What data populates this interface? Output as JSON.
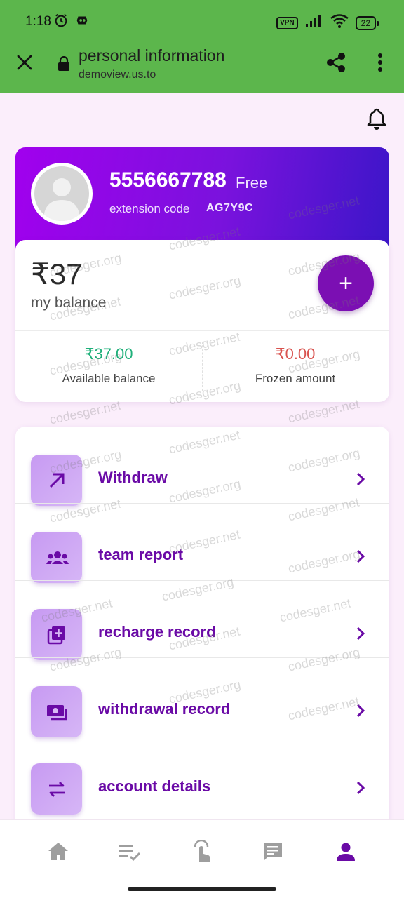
{
  "status_bar": {
    "time": "1:18",
    "vpn": "VPN",
    "battery": "22"
  },
  "browser": {
    "title": "personal information",
    "url": "demoview.us.to"
  },
  "profile": {
    "phone": "5556667788",
    "tier": "Free",
    "extension_label": "extension code",
    "extension_code": "AG7Y9C"
  },
  "balance": {
    "amount": "₹37",
    "label": "my balance",
    "add_symbol": "+",
    "available_value": "₹37.00",
    "available_label": "Available balance",
    "frozen_value": "₹0.00",
    "frozen_label": "Frozen amount"
  },
  "menu": [
    {
      "label": "Withdraw",
      "icon": "arrow-up-right-icon"
    },
    {
      "label": "team report",
      "icon": "group-icon"
    },
    {
      "label": "recharge record",
      "icon": "add-to-queue-icon"
    },
    {
      "label": "withdrawal record",
      "icon": "payments-icon"
    },
    {
      "label": "account details",
      "icon": "swap-icon"
    }
  ],
  "bottom_nav": [
    {
      "icon": "home-icon",
      "active": false
    },
    {
      "icon": "list-check-icon",
      "active": false
    },
    {
      "icon": "touch-app-icon",
      "active": false
    },
    {
      "icon": "chat-icon",
      "active": false
    },
    {
      "icon": "person-icon",
      "active": true
    }
  ],
  "watermarks": [
    "codesger.net",
    "codesger.org"
  ],
  "colors": {
    "header_green": "#5cb64c",
    "accent_purple": "#7b0fb3",
    "menu_text": "#6a0aa6",
    "available_green": "#1fb07a",
    "frozen_red": "#d9534f",
    "gradient_start": "#a100ee",
    "gradient_end": "#3a16c8"
  }
}
